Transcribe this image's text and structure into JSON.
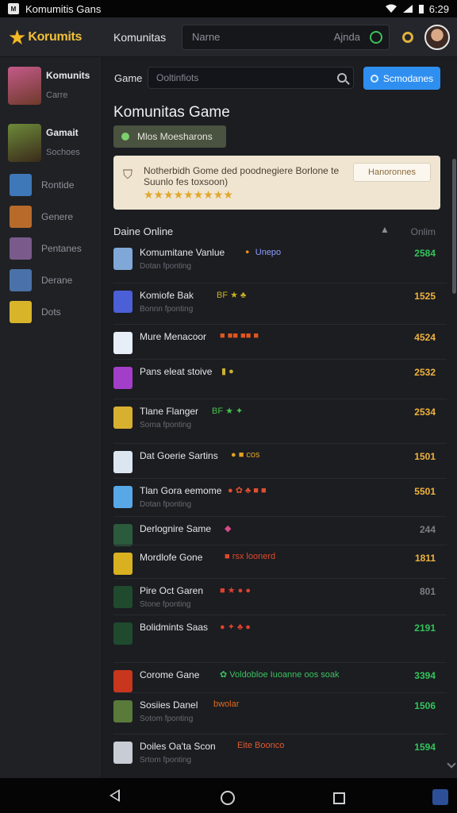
{
  "status_bar": {
    "app_title": "Komumitis Gans",
    "time": "6:29"
  },
  "topbar": {
    "logo_text": "Korumits",
    "nav_title": "Komunitas",
    "search_placeholder": "Narne",
    "search_right": "Ajnda"
  },
  "sidebar": {
    "users": [
      {
        "name": "Komunits",
        "sub": "Carre",
        "color": "#c45a8a"
      },
      {
        "name": "Gamait",
        "sub": "Sochoes",
        "color": "#6d8a3a"
      }
    ],
    "items": [
      {
        "label": "Rontide",
        "color": "#3f78b8"
      },
      {
        "label": "Genere",
        "color": "#b86a2a"
      },
      {
        "label": "Pentanes",
        "color": "#7a5a8a"
      },
      {
        "label": "Derane",
        "color": "#4a72a8"
      },
      {
        "label": "Dots",
        "color": "#d8b42a"
      }
    ]
  },
  "main": {
    "toolbar_label": "Game",
    "filter_placeholder": "Ooltinfiots",
    "primary_button": "Scmodanes",
    "page_title": "Komunitas Game",
    "members_button": "Mlos Moesharons",
    "banner": {
      "text": "Notherbidh Gome ded poodnegiere Borlone te Suunlo fes toxsoon)",
      "stars": "★★★★★★★★★",
      "button": "Hanoronnes"
    },
    "section_title": "Daine Online",
    "section_col": "Onlim",
    "games": [
      {
        "name": "Komumitane Vanlue",
        "tags": "🔸 Unepo",
        "tag_color": "#8e9bff",
        "sub": "Dotan fponting",
        "count": "2584",
        "count_color": "#33c35a",
        "icon": "#7fa8d8"
      },
      {
        "name": "Komiofe Bak",
        "tags": "BF ★ ♣",
        "tag_color": "#c8b020",
        "sub": "Bonnn fponting",
        "count": "1525",
        "count_color": "#f0b23a",
        "icon": "#4b5fd6"
      },
      {
        "name": "Mure Menacoor",
        "tags": "■ ■■ ■■ ■",
        "tag_color": "#e0561e",
        "sub": "",
        "count": "4524",
        "count_color": "#f0b23a",
        "icon": "#e8eef8"
      },
      {
        "name": "Pans eleat stoive",
        "tags": "▮ ●",
        "tag_color": "#c9b030",
        "sub": "",
        "count": "2532",
        "count_color": "#f0b23a",
        "icon": "#a33ec8"
      },
      {
        "name": "Tlane Flanger",
        "tags": "BF ★ ✦",
        "tag_color": "#48c050",
        "sub": "Sorna fponting",
        "count": "2534",
        "count_color": "#f0b23a",
        "icon": "#d8b030"
      },
      {
        "name": "Dat Goerie Sartins",
        "tags": "● ■ cos",
        "tag_color": "#e0a020",
        "sub": "",
        "count": "1501",
        "count_color": "#f0b23a",
        "icon": "#dce6f0"
      },
      {
        "name": "Tlan Gora eemome",
        "tags": "● ✿ ♣ ■ ■",
        "tag_color": "#e05030",
        "sub": "Dotan fponting",
        "count": "5501",
        "count_color": "#f0b23a",
        "icon": "#58a8e8"
      },
      {
        "name": "Derlognire Same",
        "tags": "◆",
        "tag_color": "#d84a8a",
        "sub": "",
        "count": "244",
        "count_color": "#7b7e85",
        "icon": "#2c5a3c"
      },
      {
        "name": "Mordlofe Gone",
        "tags": "■ rsx loonerd",
        "tag_color": "#e04a2a",
        "sub": "",
        "count": "1811",
        "count_color": "#f0b23a",
        "icon": "#d8b020"
      },
      {
        "name": "Pire Oct Garen",
        "tags": "■ ★ ● ●",
        "tag_color": "#e04030",
        "sub": "Stone fponting",
        "count": "801",
        "count_color": "#7b7e85",
        "icon": "#1f4a2e"
      },
      {
        "name": "Bolidmints Saas",
        "tags": "● ✦ ♣ ●",
        "tag_color": "#e04030",
        "sub": "",
        "count": "2191",
        "count_color": "#33c35a",
        "icon": "#1f4a2e"
      },
      {
        "name": "Corome Gane",
        "tags": "✿ Voldobloe Iuoanne oos soak",
        "tag_color": "#3cc060",
        "sub": "",
        "count": "3394",
        "count_color": "#33c35a",
        "icon": "#c8361e"
      },
      {
        "name": "Sosiies Danel",
        "tags": "bwolar",
        "tag_color": "#e06a20",
        "sub": "Sotom fponting",
        "count": "1506",
        "count_color": "#33c35a",
        "icon": "#5a7a3a"
      },
      {
        "name": "Doiles Oa'ta Scon",
        "tags": "Eite Boonco",
        "tag_color": "#e05a30",
        "sub": "Srtom fponting",
        "count": "1594",
        "count_color": "#33c35a",
        "icon": "#c8ccd4"
      }
    ]
  }
}
